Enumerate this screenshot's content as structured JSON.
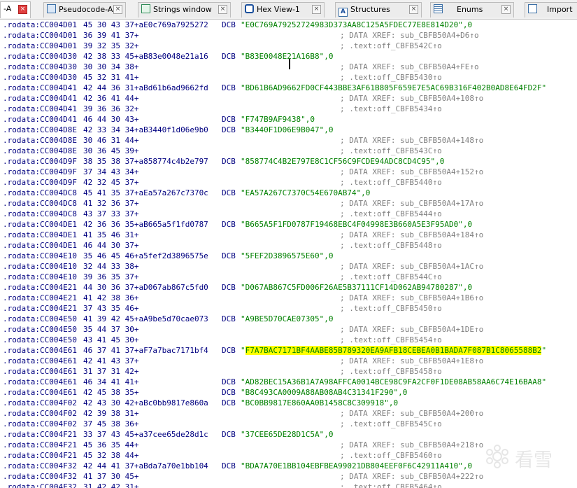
{
  "tabs": [
    {
      "label": "-A",
      "icon": "ida-view-icon",
      "active": true
    },
    {
      "label": "Pseudocode-A",
      "icon": "pseudocode-icon"
    },
    {
      "label": "Strings window",
      "icon": "strings-icon"
    },
    {
      "label": "Hex View-1",
      "icon": "hex-view-icon"
    },
    {
      "label": "Structures",
      "icon": "structures-icon"
    },
    {
      "label": "Enums",
      "icon": "enums-icon"
    },
    {
      "label": "Import",
      "icon": "imports-icon"
    }
  ],
  "listing": [
    {
      "addr": ".rodata:CC004D01",
      "bytes": "45 30 43 37+aE0c769a7925272",
      "dcb": "DCB",
      "str": "\"E0C769A79252724983D373AA8C125A5FDEC77E8E814D20\",0"
    },
    {
      "addr": ".rodata:CC004D01",
      "bytes": "36 39 41 37+",
      "cmt": "; DATA XREF: sub_CBFB50A4+D6↑o"
    },
    {
      "addr": ".rodata:CC004D01",
      "bytes": "39 32 35 32+",
      "cmt": "; .text:off_CBFB542C↑o"
    },
    {
      "addr": ".rodata:CC004D30",
      "bytes": "42 38 33 45+aB83e0048e21a16",
      "dcb": "DCB",
      "str": "\"B83E0048E21A16B8\",0"
    },
    {
      "addr": ".rodata:CC004D30",
      "bytes": "30 30 34 38+",
      "cmt": "; DATA XREF: sub_CBFB50A4+FE↑o"
    },
    {
      "addr": ".rodata:CC004D30",
      "bytes": "45 32 31 41+",
      "cmt": "; .text:off_CBFB5430↑o"
    },
    {
      "addr": ".rodata:CC004D41",
      "bytes": "42 44 36 31+aBd61b6ad9662fd",
      "dcb": "DCB",
      "str": "\"BD61B6AD9662FD0CF443BBE3AF61B805F659E7E5AC69B316F402B0AD8E64FD2F\""
    },
    {
      "addr": ".rodata:CC004D41",
      "bytes": "42 36 41 44+",
      "cmt": "; DATA XREF: sub_CBFB50A4+108↑o"
    },
    {
      "addr": ".rodata:CC004D41",
      "bytes": "39 36 36 32+",
      "cmt": "; .text:off_CBFB5434↑o"
    },
    {
      "addr": ".rodata:CC004D41",
      "bytes": "46 44 30 43+",
      "dcb": "DCB",
      "str": "\"F747B9AF9438\",0"
    },
    {
      "addr": ".rodata:CC004D8E",
      "bytes": "42 33 34 34+aB3440f1d06e9b0",
      "dcb": "DCB",
      "str": "\"B3440F1D06E9B047\",0"
    },
    {
      "addr": ".rodata:CC004D8E",
      "bytes": "30 46 31 44+",
      "cmt": "; DATA XREF: sub_CBFB50A4+148↑o"
    },
    {
      "addr": ".rodata:CC004D8E",
      "bytes": "30 36 45 39+",
      "cmt": "; .text:off_CBFB543C↑o"
    },
    {
      "addr": ".rodata:CC004D9F",
      "bytes": "38 35 38 37+a858774c4b2e797",
      "dcb": "DCB",
      "str": "\"858774C4B2E797E8C1CF56C9FCDE94ADC8CD4C95\",0"
    },
    {
      "addr": ".rodata:CC004D9F",
      "bytes": "37 34 43 34+",
      "cmt": "; DATA XREF: sub_CBFB50A4+152↑o"
    },
    {
      "addr": ".rodata:CC004D9F",
      "bytes": "42 32 45 37+",
      "cmt": "; .text:off_CBFB5440↑o"
    },
    {
      "addr": ".rodata:CC004DC8",
      "bytes": "45 41 35 37+aEa57a267c7370c",
      "dcb": "DCB",
      "str": "\"EA57A267C7370C54E670AB74\",0"
    },
    {
      "addr": ".rodata:CC004DC8",
      "bytes": "41 32 36 37+",
      "cmt": "; DATA XREF: sub_CBFB50A4+17A↑o"
    },
    {
      "addr": ".rodata:CC004DC8",
      "bytes": "43 37 33 37+",
      "cmt": "; .text:off_CBFB5444↑o"
    },
    {
      "addr": ".rodata:CC004DE1",
      "bytes": "42 36 36 35+aB665a5f1fd0787",
      "dcb": "DCB",
      "str": "\"B665A5F1FD0787F19468EBC4F04998E3B660A5E3F95AD0\",0"
    },
    {
      "addr": ".rodata:CC004DE1",
      "bytes": "41 35 46 31+",
      "cmt": "; DATA XREF: sub_CBFB50A4+184↑o"
    },
    {
      "addr": ".rodata:CC004DE1",
      "bytes": "46 44 30 37+",
      "cmt": "; .text:off_CBFB5448↑o"
    },
    {
      "addr": ".rodata:CC004E10",
      "bytes": "35 46 45 46+a5fef2d3896575e",
      "dcb": "DCB",
      "str": "\"5FEF2D3896575E60\",0"
    },
    {
      "addr": ".rodata:CC004E10",
      "bytes": "32 44 33 38+",
      "cmt": "; DATA XREF: sub_CBFB50A4+1AC↑o"
    },
    {
      "addr": ".rodata:CC004E10",
      "bytes": "39 36 35 37+",
      "cmt": "; .text:off_CBFB544C↑o"
    },
    {
      "addr": ".rodata:CC004E21",
      "bytes": "44 30 36 37+aD067ab867c5fd0",
      "dcb": "DCB",
      "str": "\"D067AB867C5FD006F26AE5B37111CF14D062AB94780287\",0"
    },
    {
      "addr": ".rodata:CC004E21",
      "bytes": "41 42 38 36+",
      "cmt": "; DATA XREF: sub_CBFB50A4+1B6↑o"
    },
    {
      "addr": ".rodata:CC004E21",
      "bytes": "37 43 35 46+",
      "cmt": "; .text:off_CBFB5450↑o"
    },
    {
      "addr": ".rodata:CC004E50",
      "bytes": "41 39 42 45+aA9be5d70cae073",
      "dcb": "DCB",
      "str": "\"A9BE5D70CAE07305\",0"
    },
    {
      "addr": ".rodata:CC004E50",
      "bytes": "35 44 37 30+",
      "cmt": "; DATA XREF: sub_CBFB50A4+1DE↑o"
    },
    {
      "addr": ".rodata:CC004E50",
      "bytes": "43 41 45 30+",
      "cmt": "; .text:off_CBFB5454↑o"
    },
    {
      "addr": ".rodata:CC004E61",
      "bytes": "46 37 41 37+aF7a7bac7171bf4",
      "dcb": "DCB",
      "str_pre": "\"",
      "str_hl": "F7A7BAC7171BF4AABE85B789320EA9AFB18CEBEA0B1BADA7F087B1C8065588B2",
      "str_post": "\""
    },
    {
      "addr": ".rodata:CC004E61",
      "bytes": "42 41 43 37+",
      "cmt": "; DATA XREF: sub_CBFB50A4+1E8↑o"
    },
    {
      "addr": ".rodata:CC004E61",
      "bytes": "31 37 31 42+",
      "cmt": "; .text:off_CBFB5458↑o"
    },
    {
      "addr": ".rodata:CC004E61",
      "bytes": "46 34 41 41+",
      "dcb": "DCB",
      "str": "\"AD82BEC15A36B1A7A98AFFCA0014BCE98C9FA2CF0F1DE08AB58AA6C74E16BAA8\""
    },
    {
      "addr": ".rodata:CC004E61",
      "bytes": "42 45 38 35+",
      "dcb": "DCB",
      "str": "\"B8C493CA0009A88AB08AB4C31341F290\",0"
    },
    {
      "addr": ".rodata:CC004F02",
      "bytes": "42 43 30 42+aBc0bb9817e860a",
      "dcb": "DCB",
      "str": "\"BC0BB9817E860AA0B1458C8C309918\",0"
    },
    {
      "addr": ".rodata:CC004F02",
      "bytes": "42 39 38 31+",
      "cmt": "; DATA XREF: sub_CBFB50A4+200↑o"
    },
    {
      "addr": ".rodata:CC004F02",
      "bytes": "37 45 38 36+",
      "cmt": "; .text:off_CBFB545C↑o"
    },
    {
      "addr": ".rodata:CC004F21",
      "bytes": "33 37 43 45+a37cee65de28d1c",
      "dcb": "DCB",
      "str": "\"37CEE65DE28D1C5A\",0"
    },
    {
      "addr": ".rodata:CC004F21",
      "bytes": "45 36 35 44+",
      "cmt": "; DATA XREF: sub_CBFB50A4+218↑o"
    },
    {
      "addr": ".rodata:CC004F21",
      "bytes": "45 32 38 44+",
      "cmt": "; .text:off_CBFB5460↑o"
    },
    {
      "addr": ".rodata:CC004F32",
      "bytes": "42 44 41 37+aBda7a70e1bb104",
      "dcb": "DCB",
      "str": "\"BDA7A70E1BB104EBFBEA99021DB804EEF0F6C42911A410\",0"
    },
    {
      "addr": ".rodata:CC004F32",
      "bytes": "41 37 30 45+",
      "cmt": "; DATA XREF: sub_CBFB50A4+222↑o"
    },
    {
      "addr": ".rodata:CC004F32",
      "bytes": "31 42 42 31+",
      "cmt": "; .text:off_CBFB5464↑o"
    }
  ],
  "watermark": {
    "text": "看雪",
    "icon": "kanxue-logo-icon"
  },
  "colors": {
    "address": "#000080",
    "string": "#008000",
    "comment": "#808080",
    "highlight": "#ffff00",
    "active_close": "#e04040"
  }
}
